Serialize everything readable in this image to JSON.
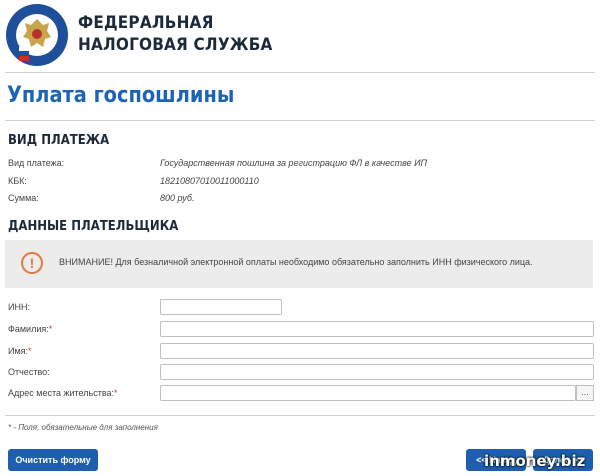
{
  "header": {
    "logo_icon": "fns-emblem-icon",
    "logo_ring_text": "ФЕДЕРАЛЬНАЯ НАЛОГОВАЯ СЛУЖБА",
    "org_name_line1": "ФЕДЕРАЛЬНАЯ",
    "org_name_line2": "НАЛОГОВАЯ СЛУЖБА"
  },
  "page": {
    "title": "Уплата госпошлины"
  },
  "payment_type": {
    "section_title": "ВИД ПЛАТЕЖА",
    "rows": [
      {
        "label": "Вид платежа:",
        "value": "Государственная пошлина за регистрацию ФЛ в качестве ИП"
      },
      {
        "label": "КБК:",
        "value": "18210807010011000110"
      },
      {
        "label": "Сумма:",
        "value": "800 руб."
      }
    ]
  },
  "payer": {
    "section_title": "ДАННЫЕ ПЛАТЕЛЬЩИКА",
    "alert": {
      "icon": "exclamation-circle-icon",
      "text": "ВНИМАНИЕ! Для безналичной электронной оплаты необходимо обязательно заполнить ИНН физического лица."
    },
    "fields": {
      "inn": {
        "label": "ИНН:",
        "value": ""
      },
      "surname": {
        "label": "Фамилия:",
        "value": ""
      },
      "name": {
        "label": "Имя:",
        "value": ""
      },
      "patronymic": {
        "label": "Отчество:",
        "value": ""
      },
      "address": {
        "label": "Адрес места жительства:",
        "value": "",
        "picker_label": "..."
      }
    },
    "required_mark": "*"
  },
  "footer": {
    "required_note": "* - Поля, обязательные для заполнения",
    "clear_button": "Очистить форму",
    "back_button": "<< Назад",
    "next_button": "Далее >>"
  },
  "watermark": "inmoney.biz",
  "colors": {
    "accent": "#1d64b6",
    "button": "#1d5fae",
    "alert_icon": "#e07a3c",
    "required": "#dd3333"
  }
}
